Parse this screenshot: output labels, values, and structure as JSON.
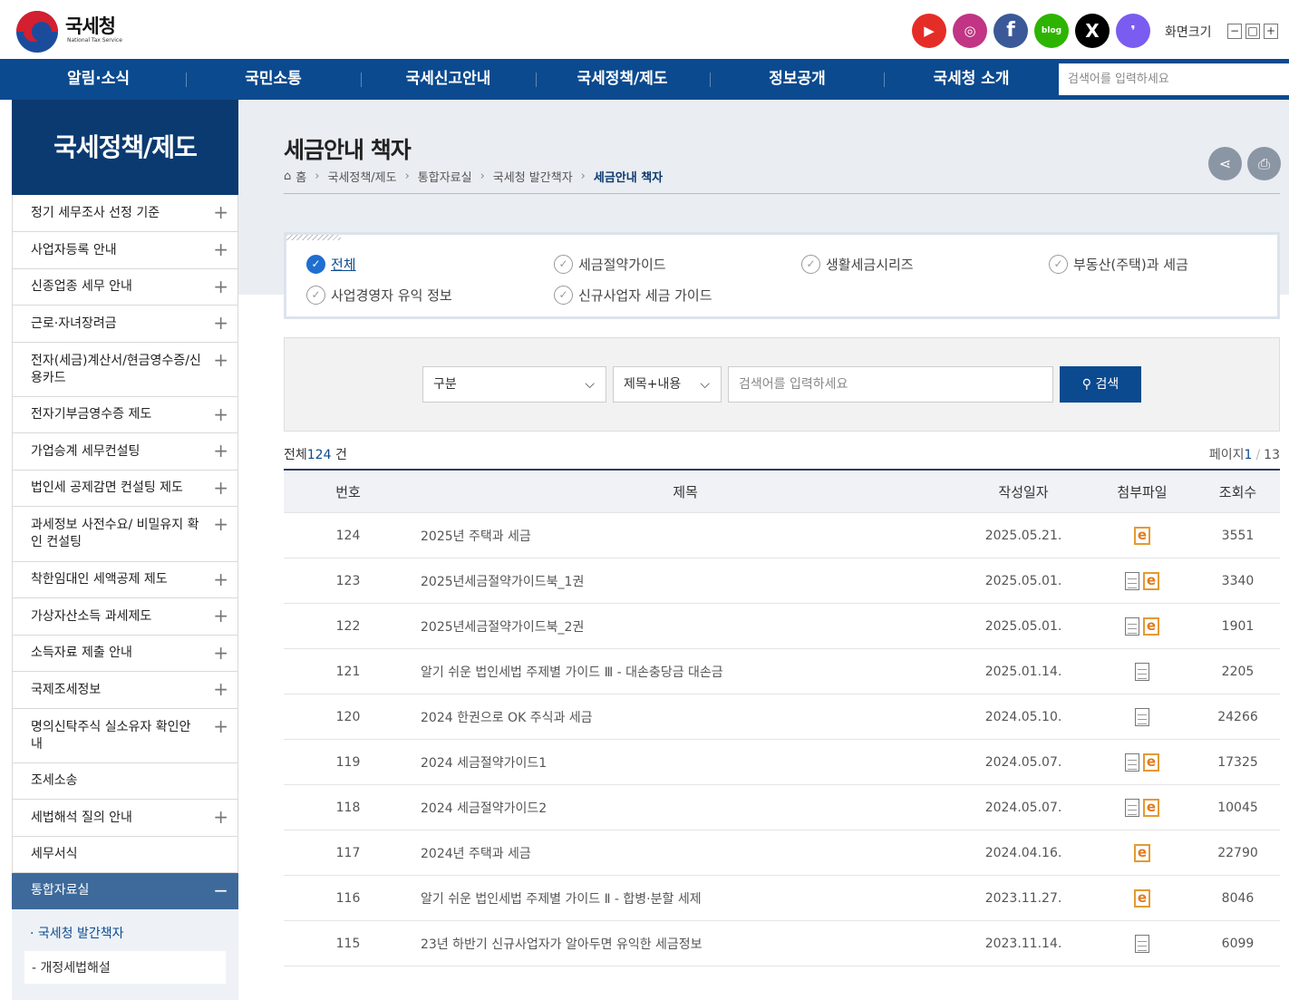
{
  "header": {
    "logo_kr": "국세청",
    "logo_en": "National Tax Service",
    "font_size_label": "화면크기",
    "font_minus": "−",
    "font_reset": "□",
    "font_plus": "+",
    "sns": [
      "youtube-icon",
      "instagram-icon",
      "facebook-icon",
      "blog-icon",
      "x-icon",
      "story-icon"
    ]
  },
  "gnb": {
    "items": [
      "알림·소식",
      "국민소통",
      "국세신고안내",
      "국세정책/제도",
      "정보공개",
      "국세청 소개"
    ],
    "search_placeholder": "검색어를 입력하세요"
  },
  "lnb": {
    "title": "국세정책/제도",
    "items": [
      "정기 세무조사 선정 기준",
      "사업자등록 안내",
      "신종업종 세무 안내",
      "근로·자녀장려금",
      "전자(세금)계산서/현금영수증/신용카드",
      "전자기부금영수증 제도",
      "가업승계 세무컨설팅",
      "법인세 공제감면 컨설팅 제도",
      "과세정보 사전수요/ 비밀유지 확인 컨설팅",
      "착한임대인 세액공제 제도",
      "가상자산소득 과세제도",
      "소득자료 제출 안내",
      "국제조세정보",
      "명의신탁주식 실소유자 확인안내",
      "조세소송",
      "세법해석 질의 안내",
      "세무서식",
      "통합자료실"
    ],
    "sub1": "· 국세청 발간책자",
    "sub2": "- 개정세법해설"
  },
  "page": {
    "title": "세금안내 책자",
    "breadcrumb": [
      "홈",
      "국세정책/제도",
      "통합자료실",
      "국세청 발간책자",
      "세금안내 책자"
    ]
  },
  "categories": [
    "전체",
    "세금절약가이드",
    "생활세금시리즈",
    "부동산(주택)과 세금",
    "사업경영자 유익 정보",
    "신규사업자 세금 가이드"
  ],
  "search": {
    "select1": "구분",
    "select2": "제목+내용",
    "placeholder": "검색어를 입력하세요",
    "button": "검색"
  },
  "list": {
    "total_label": "전체",
    "total_count": "124",
    "total_unit": " 건",
    "page_label": "페이지",
    "page_current": "1",
    "page_sep": "/",
    "page_total": "13",
    "headers": [
      "번호",
      "제목",
      "작성일자",
      "첨부파일",
      "조회수"
    ],
    "rows": [
      {
        "no": "124",
        "title": "2025년 주택과 세금",
        "date": "2025.05.21.",
        "files": [
          "e"
        ],
        "views": "3551"
      },
      {
        "no": "123",
        "title": "2025년세금절약가이드북_1권",
        "date": "2025.05.01.",
        "files": [
          "doc",
          "e"
        ],
        "views": "3340"
      },
      {
        "no": "122",
        "title": "2025년세금절약가이드북_2권",
        "date": "2025.05.01.",
        "files": [
          "doc",
          "e"
        ],
        "views": "1901"
      },
      {
        "no": "121",
        "title": "알기 쉬운 법인세법 주제별 가이드 Ⅲ - 대손충당금 대손금",
        "date": "2025.01.14.",
        "files": [
          "doc"
        ],
        "views": "2205"
      },
      {
        "no": "120",
        "title": "2024 한권으로 OK 주식과 세금",
        "date": "2024.05.10.",
        "files": [
          "doc"
        ],
        "views": "24266"
      },
      {
        "no": "119",
        "title": "2024 세금절약가이드1",
        "date": "2024.05.07.",
        "files": [
          "doc",
          "e"
        ],
        "views": "17325"
      },
      {
        "no": "118",
        "title": "2024 세금절약가이드2",
        "date": "2024.05.07.",
        "files": [
          "doc",
          "e"
        ],
        "views": "10045"
      },
      {
        "no": "117",
        "title": "2024년 주택과 세금",
        "date": "2024.04.16.",
        "files": [
          "e"
        ],
        "views": "22790"
      },
      {
        "no": "116",
        "title": "알기 쉬운 법인세법 주제별 가이드 Ⅱ - 합병·분할 세제",
        "date": "2023.11.27.",
        "files": [
          "e"
        ],
        "views": "8046"
      },
      {
        "no": "115",
        "title": "23년 하반기 신규사업자가 알아두면 유익한 세금정보",
        "date": "2023.11.14.",
        "files": [
          "doc"
        ],
        "views": "6099"
      }
    ]
  },
  "colors": {
    "primary": "#0b4a8f",
    "lnb_head": "#0a3a70",
    "active": "#3d6a9b"
  }
}
